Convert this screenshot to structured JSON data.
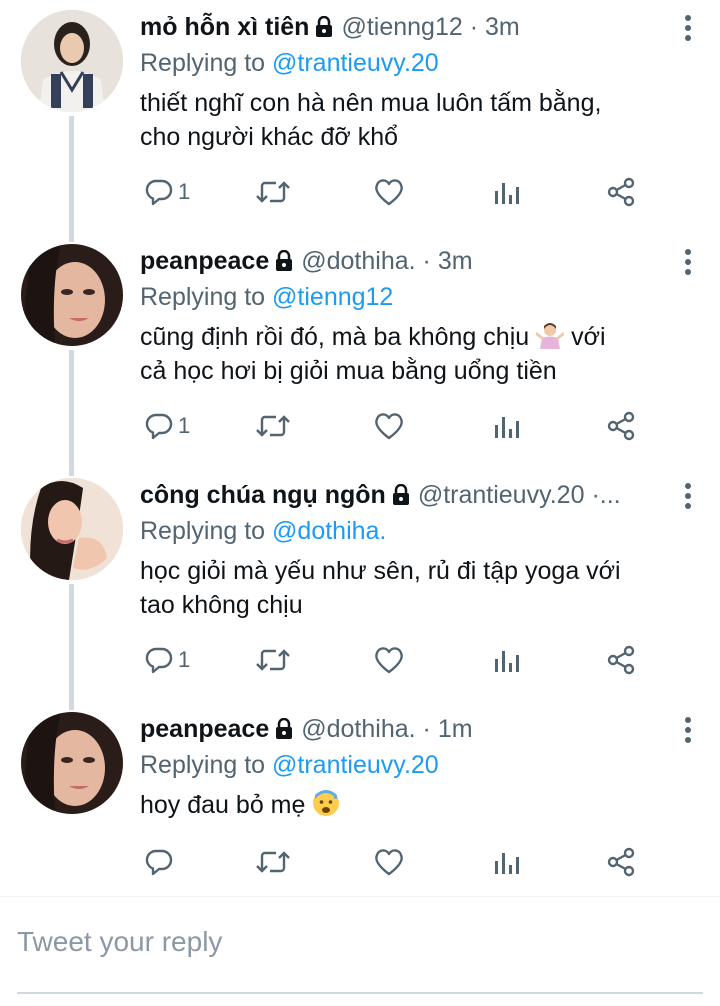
{
  "tweets": [
    {
      "name": "mỏ hỗn xì tiên",
      "handle": "@tienng12",
      "dot": "·",
      "time": "3m",
      "replying_prefix": "Replying to",
      "replying_to": "@trantieuvy.20",
      "text_line1": "thiết nghĩ con hà nên mua luôn tấm bằng,",
      "text_line2": "cho người khác đỡ khổ",
      "reply_count": "1"
    },
    {
      "name": "peanpeace",
      "handle": "@dothiha.",
      "dot": "·",
      "time": "3m",
      "replying_prefix": "Replying to",
      "replying_to": "@tienng12",
      "text_line1": "cũng định rồi đó, mà ba không chịu",
      "text_line1_after": "với",
      "text_line2": "cả học hơi bị giỏi mua bằng uổng tiền",
      "emoji": "person-shrugging",
      "reply_count": "1"
    },
    {
      "name": "công chúa ngụ ngôn",
      "handle": "@trantieuvy.20",
      "dot": "·...",
      "time": "",
      "replying_prefix": "Replying to",
      "replying_to": "@dothiha.",
      "text_line1": "học giỏi mà yếu như sên, rủ đi tập yoga với",
      "text_line2": "tao không chịu",
      "reply_count": "1"
    },
    {
      "name": "peanpeace",
      "handle": "@dothiha.",
      "dot": "·",
      "time": "1m",
      "replying_prefix": "Replying to",
      "replying_to": "@trantieuvy.20",
      "text_line1": "hoy đau bỏ mẹ",
      "emoji": "anxious-face-with-sweat",
      "reply_count": ""
    }
  ],
  "reply_box": {
    "placeholder": "Tweet your reply"
  },
  "colors": {
    "accent": "#1d9bf0",
    "secondary_text": "#536471",
    "primary_text": "#0f1419"
  }
}
